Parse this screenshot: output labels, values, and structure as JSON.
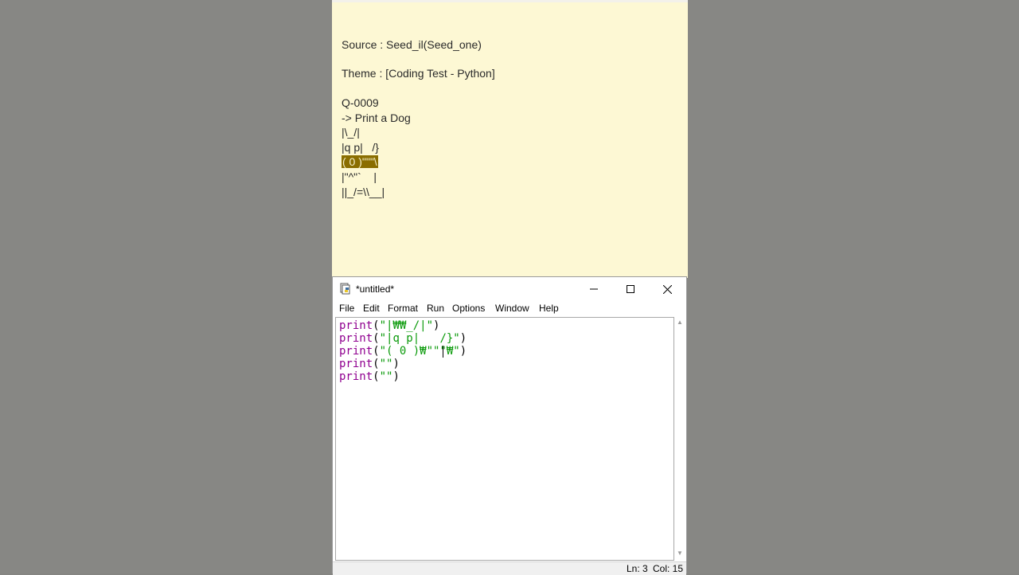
{
  "note": {
    "source": "Source : Seed_il(Seed_one)",
    "theme": "Theme : [Coding Test - Python]",
    "question_id": "Q-0009",
    "question": "-> Print a Dog",
    "art": [
      "|\\_/|",
      "|q p|   /}",
      "( 0 )\"\"\"\\",
      "|\"^\"`    |",
      "||_/=\\\\__|"
    ]
  },
  "window": {
    "title": "*untitled*",
    "menu": [
      "File",
      "Edit",
      "Format",
      "Run",
      "Options",
      "Window",
      "Help"
    ],
    "code": [
      {
        "kw": "print",
        "open": "(",
        "str": "\"|₩₩_/|\"",
        "close": ")"
      },
      {
        "kw": "print",
        "open": "(",
        "str": "\"|q p|   /}\"",
        "close": ")"
      },
      {
        "kw": "print",
        "open": "(",
        "str": "\"( 0 )₩\"\"\"₩\"",
        "close": ")"
      },
      {
        "kw": "print",
        "open": "(",
        "str": "\"\"",
        "close": ")"
      },
      {
        "kw": "print",
        "open": "(",
        "str": "\"\"",
        "close": ")"
      }
    ],
    "status": {
      "ln": "Ln: 3",
      "col": "Col: 15"
    }
  },
  "colors": {
    "keyword": "#900090",
    "string": "#0a9a0a",
    "note_bg": "#fdf8d4",
    "highlight": "#8a6d00"
  },
  "icons": {
    "app": "python-idle-icon",
    "minimize": "minimize-icon",
    "maximize": "maximize-icon",
    "close": "close-icon"
  }
}
